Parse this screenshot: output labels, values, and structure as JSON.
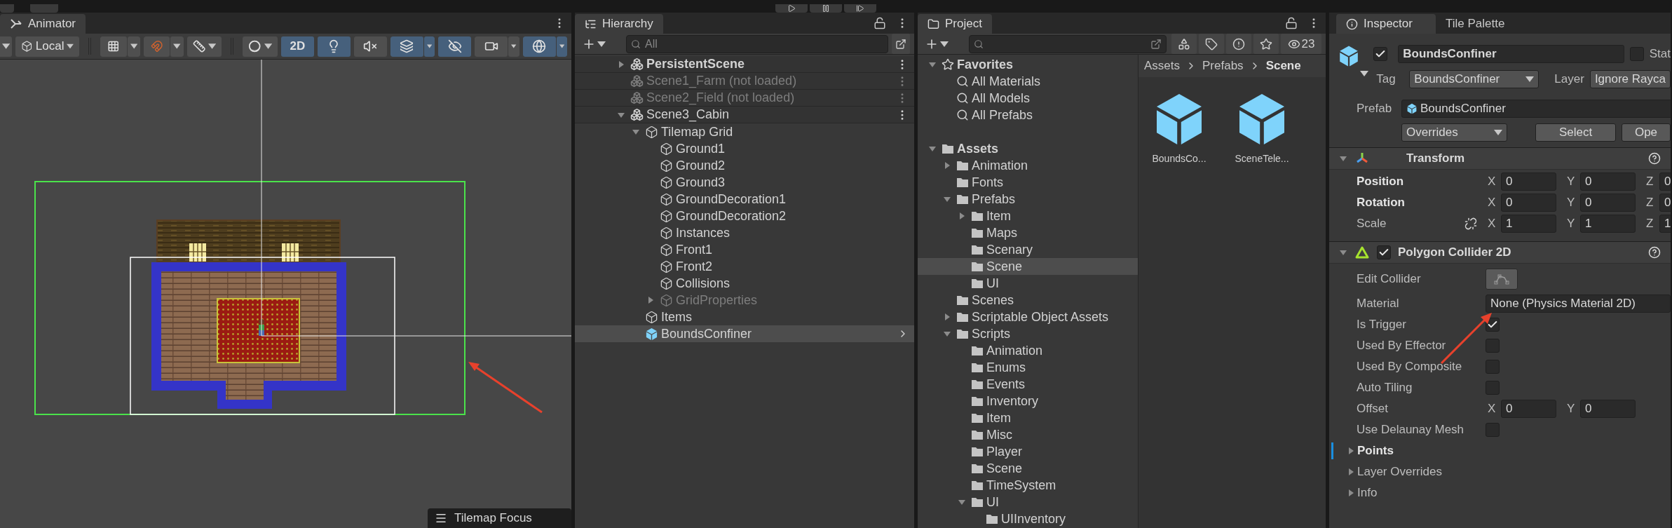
{
  "scene_view": {
    "tab": "Animator",
    "toolbar": {
      "pivot_dropdown": "Local",
      "toggles": [
        {
          "kind": "mode_2d",
          "label": "2D",
          "selected": true,
          "has_menu": false
        },
        {
          "kind": "lighting",
          "selected": true,
          "has_menu": false
        },
        {
          "kind": "audio",
          "selected": false,
          "has_menu": false
        },
        {
          "kind": "effects",
          "selected": true,
          "has_menu": true
        },
        {
          "kind": "visibility",
          "selected": true,
          "has_menu": false
        },
        {
          "kind": "camera",
          "selected": false,
          "has_menu": true
        },
        {
          "kind": "gizmos",
          "selected": true,
          "has_menu": true
        }
      ]
    },
    "overlay": "Tilemap Focus"
  },
  "hierarchy": {
    "title": "Hierarchy",
    "search": {
      "placeholder": "All"
    },
    "items": [
      {
        "label": "PersistentScene",
        "kind": "scene",
        "expanded": false,
        "active": true,
        "disabled": false,
        "selected": false
      },
      {
        "label": "Scene1_Farm (not loaded)",
        "kind": "scene",
        "active": false,
        "disabled": true,
        "selected": false
      },
      {
        "label": "Scene2_Field (not loaded)",
        "kind": "scene",
        "active": false,
        "disabled": true,
        "selected": false
      },
      {
        "label": "Scene3_Cabin",
        "kind": "scene",
        "expanded": true,
        "active": false,
        "disabled": false,
        "selected": false,
        "children": [
          {
            "label": "Tilemap Grid",
            "kind": "object",
            "expanded": true,
            "disabled": false,
            "selected": false,
            "children": [
              {
                "label": "Ground1",
                "kind": "object",
                "disabled": false,
                "selected": false
              },
              {
                "label": "Ground2",
                "kind": "object",
                "disabled": false,
                "selected": false
              },
              {
                "label": "Ground3",
                "kind": "object",
                "disabled": false,
                "selected": false
              },
              {
                "label": "GroundDecoration1",
                "kind": "object",
                "disabled": false,
                "selected": false
              },
              {
                "label": "GroundDecoration2",
                "kind": "object",
                "disabled": false,
                "selected": false
              },
              {
                "label": "Instances",
                "kind": "object",
                "disabled": false,
                "selected": false
              },
              {
                "label": "Front1",
                "kind": "object",
                "disabled": false,
                "selected": false
              },
              {
                "label": "Front2",
                "kind": "object",
                "disabled": false,
                "selected": false
              },
              {
                "label": "Collisions",
                "kind": "object",
                "disabled": false,
                "selected": false
              },
              {
                "label": "GridProperties",
                "kind": "object",
                "expanded": false,
                "disabled": true,
                "selected": false
              }
            ]
          },
          {
            "label": "Items",
            "kind": "object",
            "disabled": false,
            "selected": false
          },
          {
            "label": "BoundsConfiner",
            "kind": "prefab",
            "disabled": false,
            "selected": true
          }
        ]
      }
    ]
  },
  "project": {
    "title": "Project",
    "hidden_count": "23",
    "breadcrumb": [
      "Assets",
      "Prefabs",
      "Scene"
    ],
    "tree": [
      {
        "label": "Favorites",
        "kind": "favorites",
        "expanded": true,
        "selected": false,
        "children": [
          {
            "label": "All Materials",
            "kind": "search",
            "selected": false
          },
          {
            "label": "All Models",
            "kind": "search",
            "selected": false
          },
          {
            "label": "All Prefabs",
            "kind": "search",
            "selected": false
          }
        ]
      },
      {
        "label": "Assets",
        "kind": "root",
        "expanded": true,
        "selected": false,
        "children": [
          {
            "label": "Animation",
            "kind": "folder",
            "expanded": false,
            "selected": false
          },
          {
            "label": "Fonts",
            "kind": "folder",
            "selected": false
          },
          {
            "label": "Prefabs",
            "kind": "folder",
            "expanded": true,
            "selected": false,
            "children": [
              {
                "label": "Item",
                "kind": "folder",
                "expanded": false,
                "selected": false
              },
              {
                "label": "Maps",
                "kind": "folder",
                "selected": false
              },
              {
                "label": "Scenary",
                "kind": "folder",
                "selected": false
              },
              {
                "label": "Scene",
                "kind": "folder",
                "selected": true
              },
              {
                "label": "UI",
                "kind": "folder",
                "selected": false
              }
            ]
          },
          {
            "label": "Scenes",
            "kind": "folder",
            "selected": false
          },
          {
            "label": "Scriptable Object Assets",
            "kind": "folder",
            "expanded": false,
            "selected": false
          },
          {
            "label": "Scripts",
            "kind": "folder",
            "expanded": true,
            "selected": false,
            "children": [
              {
                "label": "Animation",
                "kind": "folder",
                "selected": false
              },
              {
                "label": "Enums",
                "kind": "folder",
                "selected": false
              },
              {
                "label": "Events",
                "kind": "folder",
                "selected": false
              },
              {
                "label": "Inventory",
                "kind": "folder",
                "selected": false
              },
              {
                "label": "Item",
                "kind": "folder",
                "selected": false
              },
              {
                "label": "Misc",
                "kind": "folder",
                "selected": false
              },
              {
                "label": "Player",
                "kind": "folder",
                "selected": false
              },
              {
                "label": "Scene",
                "kind": "folder",
                "selected": false
              },
              {
                "label": "TimeSystem",
                "kind": "folder",
                "selected": false
              },
              {
                "label": "UI",
                "kind": "folder",
                "expanded": true,
                "selected": false,
                "children": [
                  {
                    "label": "UIInventory",
                    "kind": "folder",
                    "selected": false
                  }
                ]
              }
            ]
          }
        ]
      }
    ],
    "assets": [
      {
        "label": "BoundsCo..."
      },
      {
        "label": "SceneTele..."
      }
    ]
  },
  "inspector": {
    "tabs": [
      {
        "label": "Inspector",
        "selected": true
      },
      {
        "label": "Tile Palette",
        "selected": false
      }
    ],
    "object": {
      "active": true,
      "name": "BoundsConfiner",
      "static_label": "Stat",
      "static": false,
      "tag_label": "Tag",
      "tag": "BoundsConfiner",
      "layer_label": "Layer",
      "layer": "Ignore Rayca",
      "prefab_label": "Prefab",
      "prefab": "BoundsConfiner",
      "overrides": "Overrides",
      "buttons": [
        "Select",
        "Ope"
      ]
    },
    "components": [
      {
        "kind": "transform",
        "title": "Transform",
        "expanded": true,
        "rows": [
          {
            "kind": "vector",
            "label": "Position",
            "overridden": true,
            "values": [
              {
                "axis": "X",
                "value": "0"
              },
              {
                "axis": "Y",
                "value": "0"
              },
              {
                "axis": "Z",
                "value": "0"
              }
            ]
          },
          {
            "kind": "vector",
            "label": "Rotation",
            "overridden": true,
            "values": [
              {
                "axis": "X",
                "value": "0"
              },
              {
                "axis": "Y",
                "value": "0"
              },
              {
                "axis": "Z",
                "value": "0"
              }
            ]
          },
          {
            "kind": "vector",
            "label": "Scale",
            "overridden": false,
            "linked": false,
            "values": [
              {
                "axis": "X",
                "value": "1"
              },
              {
                "axis": "Y",
                "value": "1"
              },
              {
                "axis": "Z",
                "value": "1"
              }
            ]
          }
        ]
      },
      {
        "kind": "polygon_collider",
        "title": "Polygon Collider 2D",
        "enabled": true,
        "expanded": true,
        "rows": [
          {
            "kind": "edit",
            "label": "Edit Collider",
            "overridden": false
          },
          {
            "kind": "object",
            "label": "Material",
            "value": "None (Physics Material 2D)",
            "overridden": false
          },
          {
            "kind": "toggle",
            "label": "Is Trigger",
            "checked": true,
            "overridden": false
          },
          {
            "kind": "toggle",
            "label": "Used By Effector",
            "checked": false,
            "overridden": false
          },
          {
            "kind": "toggle",
            "label": "Used By Composite",
            "checked": false,
            "overridden": false
          },
          {
            "kind": "toggle",
            "label": "Auto Tiling",
            "checked": false,
            "overridden": false
          },
          {
            "kind": "vector",
            "label": "Offset",
            "overridden": false,
            "values": [
              {
                "axis": "X",
                "value": "0"
              },
              {
                "axis": "Y",
                "value": "0"
              }
            ]
          },
          {
            "kind": "toggle",
            "label": "Use Delaunay Mesh",
            "checked": false,
            "overridden": false
          },
          {
            "kind": "foldout",
            "label": "Points",
            "overridden": true
          },
          {
            "kind": "foldout",
            "label": "Layer Overrides",
            "overridden": false
          },
          {
            "kind": "foldout",
            "label": "Info",
            "overridden": false
          }
        ]
      }
    ]
  }
}
